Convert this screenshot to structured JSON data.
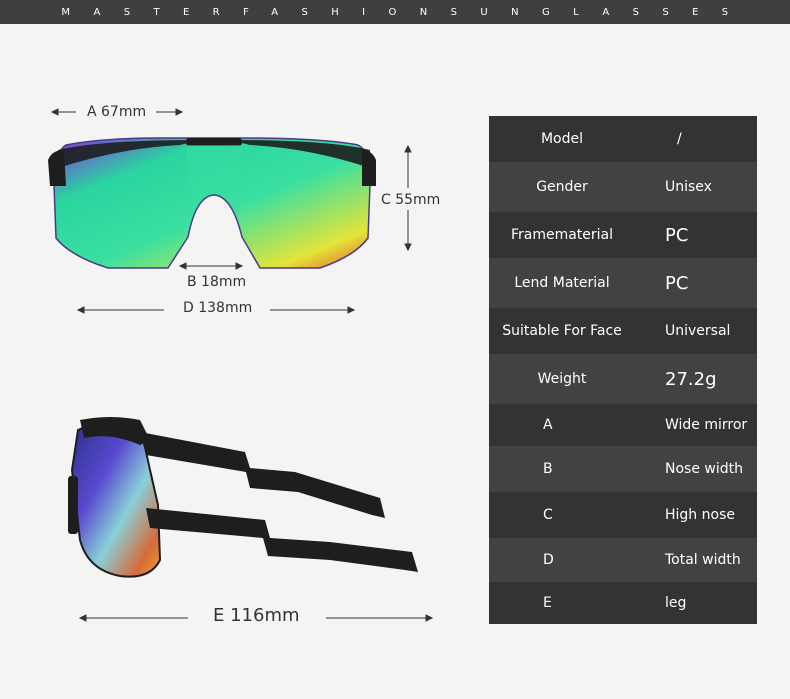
{
  "banner": {
    "text": "MASTERFASHIONSUNGLASSES"
  },
  "dimensions": {
    "a": "A 67mm",
    "b": "B 18mm",
    "c": "C 55mm",
    "d": "D 138mm",
    "e": "E 116mm"
  },
  "spec_table": [
    {
      "label": "Model",
      "value": "/"
    },
    {
      "label": "Gender",
      "value": "Unisex"
    },
    {
      "label": "Framematerial",
      "value": "PC"
    },
    {
      "label": "Lend Material",
      "value": "PC"
    },
    {
      "label": "Suitable For Face",
      "value": "Universal"
    },
    {
      "label": "Weight",
      "value": "27.2g"
    },
    {
      "label": "A",
      "value": "Wide mirror"
    },
    {
      "label": "B",
      "value": "Nose width"
    },
    {
      "label": "C",
      "value": "High nose"
    },
    {
      "label": "D",
      "value": "Total width"
    },
    {
      "label": "E",
      "value": "leg"
    }
  ],
  "colors": {
    "banner_bg": "#3f3f3f",
    "page_bg": "#f4f4f4",
    "table_bg": "#3a3a3a",
    "frame": "#1e1e1e"
  }
}
